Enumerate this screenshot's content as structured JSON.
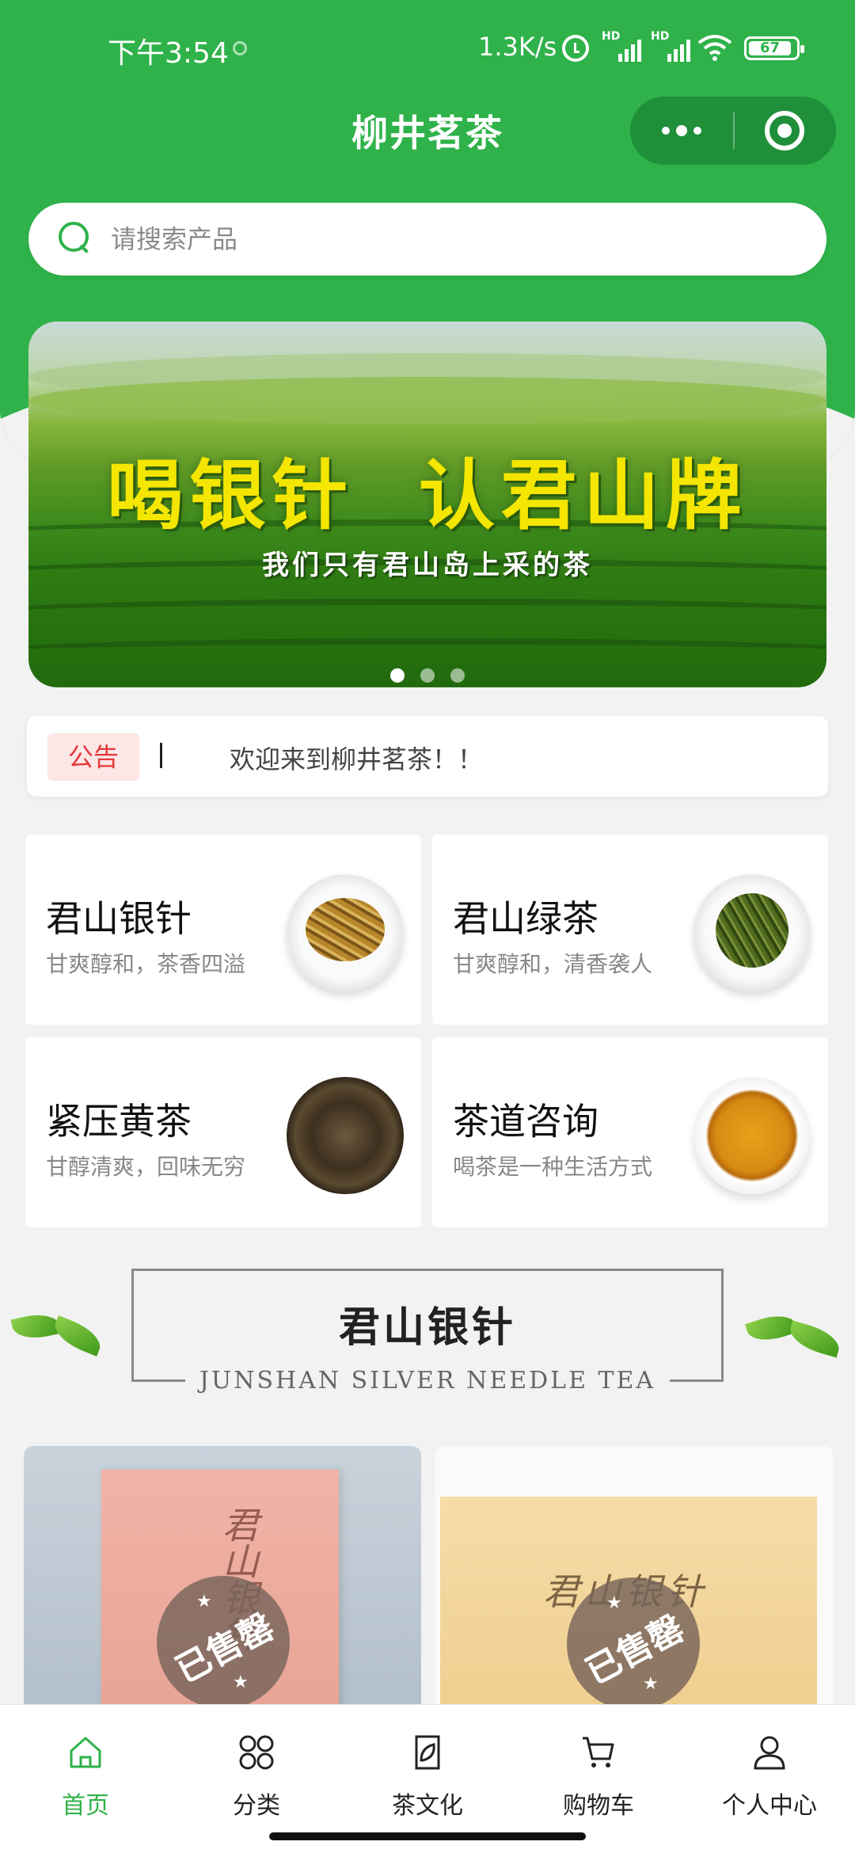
{
  "status_bar": {
    "time": "下午3:54",
    "network_speed": "1.3K/s",
    "sim1_label": "HD",
    "sim2_label": "HD",
    "battery": "67"
  },
  "header": {
    "title": "柳井茗茶",
    "more_icon": "more-dots-icon",
    "close_icon": "target-close-icon"
  },
  "search": {
    "placeholder": "请搜索产品",
    "value": ""
  },
  "banner": {
    "headline": "喝银针 认君山牌",
    "subline": "我们只有君山岛上采的茶",
    "slide_count": 3,
    "active_slide": 1
  },
  "notice": {
    "tag": "公告",
    "text": "欢迎来到柳井茗茶！！"
  },
  "categories": [
    {
      "name": "君山银针",
      "desc": "甘爽醇和，茶香四溢",
      "image": "silver-needle-tea-plate"
    },
    {
      "name": "君山绿茶",
      "desc": "甘爽醇和，清香袭人",
      "image": "green-tea-plate"
    },
    {
      "name": "紧压黄茶",
      "desc": "甘醇清爽，回味无穷",
      "image": "compressed-yellow-tea-cake"
    },
    {
      "name": "茶道咨询",
      "desc": "喝茶是一种生活方式",
      "image": "tea-cup"
    }
  ],
  "section": {
    "title": "君山银针",
    "subtitle": "JUNSHAN SILVER NEEDLE TEA"
  },
  "products": [
    {
      "box_text": "君山银针",
      "status": "已售罄"
    },
    {
      "box_text": "君山银针",
      "status": "已售罄"
    }
  ],
  "tabbar": {
    "items": [
      {
        "label": "首页",
        "icon": "home-icon",
        "active": true
      },
      {
        "label": "分类",
        "icon": "category-icon",
        "active": false
      },
      {
        "label": "茶文化",
        "icon": "tea-culture-icon",
        "active": false
      },
      {
        "label": "购物车",
        "icon": "cart-icon",
        "active": false
      },
      {
        "label": "个人中心",
        "icon": "user-icon",
        "active": false
      }
    ]
  },
  "colors": {
    "primary": "#2fb24a",
    "notice_red": "#e4393c",
    "banner_text": "#f4e600"
  }
}
